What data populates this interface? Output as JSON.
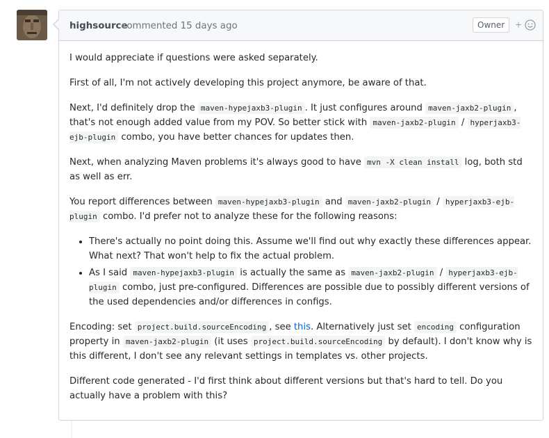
{
  "comment": {
    "author": "highsource",
    "action": "commented 15 days ago",
    "badge": "Owner",
    "reaction_plus": "+"
  },
  "body": {
    "p1": "I would appreciate if questions were asked separately.",
    "p2": "First of all, I'm not actively developing this project anymore, be aware of that.",
    "p3": {
      "t1": "Next, I'd definitely drop the ",
      "c1": "maven-hypejaxb3-plugin",
      "t2": ". It just configures around ",
      "c2": "maven-jaxb2-plugin",
      "t3": ", that's not enough added value from my POV. So better stick with ",
      "c3": "maven-jaxb2-plugin",
      "t4": " / ",
      "c4": "hyperjaxb3-ejb-plugin",
      "t5": " combo, you have better chances for updates then."
    },
    "p4": {
      "t1": "Next, when analyzing Maven problems it's always good to have ",
      "c1": "mvn -X clean install",
      "t2": " log, both std as well as err."
    },
    "p5": {
      "t1": "You report differences between ",
      "c1": "maven-hypejaxb3-plugin",
      "t2": " and ",
      "c2": "maven-jaxb2-plugin",
      "t3": " / ",
      "c3": "hyperjaxb3-ejb-plugin",
      "t4": " combo. I'd prefer not to analyze these for the following reasons:"
    },
    "li1": "There's actually no point doing this. Assume we'll find out why exactly these differences appear. What next? That won't help to fix the actual problem.",
    "li2": {
      "t1": "As I said ",
      "c1": "maven-hypejaxb3-plugin",
      "t2": " is actually the same as ",
      "c2": "maven-jaxb2-plugin",
      "t3": " / ",
      "c3": "hyperjaxb3-ejb-plugin",
      "t4": " combo, just pre-configured. Differences are possible due to possibly different versions of the used dependencies and/or differences in configs."
    },
    "p6": {
      "t1": "Encoding: set ",
      "c1": "project.build.sourceEncoding",
      "t2": ", see ",
      "link": "this",
      "t3": ". Alternatively just set ",
      "c2": "encoding",
      "t4": " configuration property in ",
      "c3": "maven-jaxb2-plugin",
      "t5": " (it uses ",
      "c4": "project.build.sourceEncoding",
      "t6": " by default). I don't know why is this different, I don't see any relevant settings in templates vs. other projects."
    },
    "p7": "Different code generated - I'd first think about different versions but that's hard to tell. Do you actually have a problem with this?"
  },
  "colors": {
    "header_bg": "#f6f8fa",
    "border": "#d1d5da",
    "link": "#0366d6",
    "code_bg": "#f3f4f4"
  },
  "icons": {
    "avatar": "user-avatar",
    "reaction": "smiley-icon"
  }
}
